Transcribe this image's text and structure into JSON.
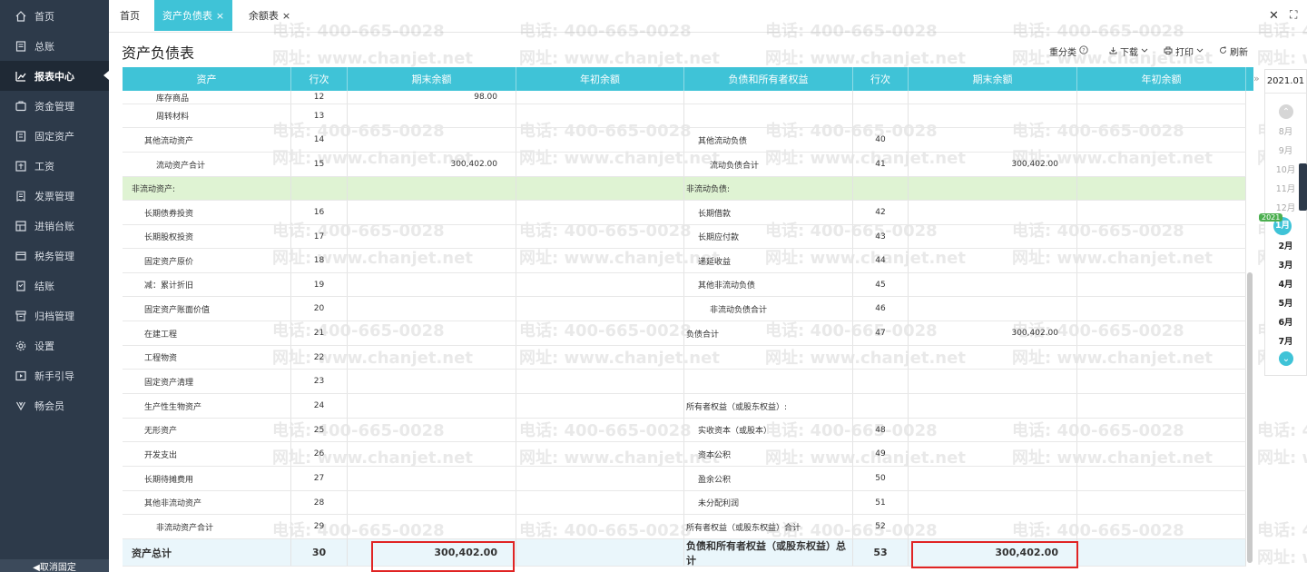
{
  "sidebar": {
    "items": [
      {
        "label": "首页",
        "icon": "home-icon"
      },
      {
        "label": "总账",
        "icon": "ledger-icon"
      },
      {
        "label": "报表中心",
        "icon": "chart-icon"
      },
      {
        "label": "资金管理",
        "icon": "funds-icon"
      },
      {
        "label": "固定资产",
        "icon": "asset-icon"
      },
      {
        "label": "工资",
        "icon": "salary-icon"
      },
      {
        "label": "发票管理",
        "icon": "invoice-icon"
      },
      {
        "label": "进销台账",
        "icon": "inventory-icon"
      },
      {
        "label": "税务管理",
        "icon": "tax-icon"
      },
      {
        "label": "结账",
        "icon": "closing-icon"
      },
      {
        "label": "归档管理",
        "icon": "archive-icon"
      },
      {
        "label": "设置",
        "icon": "settings-icon"
      },
      {
        "label": "新手引导",
        "icon": "guide-icon"
      },
      {
        "label": "畅会员",
        "icon": "vip-icon"
      }
    ],
    "active_index": 2,
    "footer_label": "◀取消固定"
  },
  "tabs": [
    {
      "label": "首页",
      "closable": false
    },
    {
      "label": "资产负债表",
      "closable": true
    },
    {
      "label": "余额表",
      "closable": true
    }
  ],
  "tab_close_glyph": "×",
  "window": {
    "close_glyph": "✕",
    "max_glyph": "⛶"
  },
  "page_title": "资产负债表",
  "toolbar": {
    "reclassify": "重分类",
    "download": "下载",
    "print": "打印",
    "refresh": "刷新"
  },
  "table": {
    "headers": [
      "资产",
      "行次",
      "期末余额",
      "年初余额",
      "负债和所有者权益",
      "行次",
      "期末余额",
      "年初余额"
    ],
    "rows": [
      {
        "left_name": "库存商品",
        "left_line": "12",
        "left_end": "98.00",
        "left_start": "",
        "right_name": "",
        "right_line": "",
        "right_end": "",
        "right_start": "",
        "li": 2,
        "ri": 0
      },
      {
        "left_name": "周转材料",
        "left_line": "13",
        "left_end": "",
        "left_start": "",
        "right_name": "",
        "right_line": "",
        "right_end": "",
        "right_start": "",
        "li": 2,
        "ri": 0
      },
      {
        "left_name": "其他流动资产",
        "left_line": "14",
        "left_end": "",
        "left_start": "",
        "right_name": "其他流动负债",
        "right_line": "40",
        "right_end": "",
        "right_start": "",
        "li": 1,
        "ri": 1
      },
      {
        "left_name": "流动资产合计",
        "left_line": "15",
        "left_end": "300,402.00",
        "left_start": "",
        "right_name": "流动负债合计",
        "right_line": "41",
        "right_end": "300,402.00",
        "right_start": "",
        "li": 2,
        "ri": 2
      },
      {
        "left_name": "非流动资产:",
        "left_line": "",
        "left_end": "",
        "left_start": "",
        "right_name": "非流动负债:",
        "right_line": "",
        "right_end": "",
        "right_start": "",
        "li": 0,
        "ri": 0,
        "section": true
      },
      {
        "left_name": "长期债券投资",
        "left_line": "16",
        "left_end": "",
        "left_start": "",
        "right_name": "长期借款",
        "right_line": "42",
        "right_end": "",
        "right_start": "",
        "li": 1,
        "ri": 1
      },
      {
        "left_name": "长期股权投资",
        "left_line": "17",
        "left_end": "",
        "left_start": "",
        "right_name": "长期应付款",
        "right_line": "43",
        "right_end": "",
        "right_start": "",
        "li": 1,
        "ri": 1
      },
      {
        "left_name": "固定资产原价",
        "left_line": "18",
        "left_end": "",
        "left_start": "",
        "right_name": "递延收益",
        "right_line": "44",
        "right_end": "",
        "right_start": "",
        "li": 1,
        "ri": 1
      },
      {
        "left_name": "减：累计折旧",
        "left_line": "19",
        "left_end": "",
        "left_start": "",
        "right_name": "其他非流动负债",
        "right_line": "45",
        "right_end": "",
        "right_start": "",
        "li": 1,
        "ri": 1
      },
      {
        "left_name": "固定资产账面价值",
        "left_line": "20",
        "left_end": "",
        "left_start": "",
        "right_name": "非流动负债合计",
        "right_line": "46",
        "right_end": "",
        "right_start": "",
        "li": 1,
        "ri": 2
      },
      {
        "left_name": "在建工程",
        "left_line": "21",
        "left_end": "",
        "left_start": "",
        "right_name": "负债合计",
        "right_line": "47",
        "right_end": "300,402.00",
        "right_start": "",
        "li": 1,
        "ri": 0
      },
      {
        "left_name": "工程物资",
        "left_line": "22",
        "left_end": "",
        "left_start": "",
        "right_name": "",
        "right_line": "",
        "right_end": "",
        "right_start": "",
        "li": 1,
        "ri": 0
      },
      {
        "left_name": "固定资产清理",
        "left_line": "23",
        "left_end": "",
        "left_start": "",
        "right_name": "",
        "right_line": "",
        "right_end": "",
        "right_start": "",
        "li": 1,
        "ri": 0
      },
      {
        "left_name": "生产性生物资产",
        "left_line": "24",
        "left_end": "",
        "left_start": "",
        "right_name": "所有者权益（或股东权益）:",
        "right_line": "",
        "right_end": "",
        "right_start": "",
        "li": 1,
        "ri": 0
      },
      {
        "left_name": "无形资产",
        "left_line": "25",
        "left_end": "",
        "left_start": "",
        "right_name": "实收资本（或股本）",
        "right_line": "48",
        "right_end": "",
        "right_start": "",
        "li": 1,
        "ri": 1
      },
      {
        "left_name": "开发支出",
        "left_line": "26",
        "left_end": "",
        "left_start": "",
        "right_name": "资本公积",
        "right_line": "49",
        "right_end": "",
        "right_start": "",
        "li": 1,
        "ri": 1
      },
      {
        "left_name": "长期待摊费用",
        "left_line": "27",
        "left_end": "",
        "left_start": "",
        "right_name": "盈余公积",
        "right_line": "50",
        "right_end": "",
        "right_start": "",
        "li": 1,
        "ri": 1
      },
      {
        "left_name": "其他非流动资产",
        "left_line": "28",
        "left_end": "",
        "left_start": "",
        "right_name": "未分配利润",
        "right_line": "51",
        "right_end": "",
        "right_start": "",
        "li": 1,
        "ri": 1
      },
      {
        "left_name": "非流动资产合计",
        "left_line": "29",
        "left_end": "",
        "left_start": "",
        "right_name": "所有者权益（或股东权益）合计",
        "right_line": "52",
        "right_end": "",
        "right_start": "",
        "li": 2,
        "ri": 0
      }
    ],
    "total_row": {
      "left_name": "资产总计",
      "left_line": "30",
      "left_end": "300,402.00",
      "right_name": "负债和所有者权益（或股东权益）总计",
      "right_line": "53",
      "right_end": "300,402.00"
    }
  },
  "period_panel": {
    "year": "2021.01",
    "year_badge": "2021",
    "months_prev": [
      "8月",
      "9月",
      "10月",
      "11月",
      "12月"
    ],
    "months_current": [
      "1月",
      "2月",
      "3月",
      "4月",
      "5月",
      "6月",
      "7月"
    ],
    "selected": "1月",
    "up_glyph": "⌃",
    "down_glyph": "⌄"
  },
  "watermark": {
    "phone": "电话: 400-665-0028",
    "site": "网址: www.chanjet.net"
  },
  "colors": {
    "accent": "#3fc3d7",
    "sidebar": "#2d3a4a",
    "section_row": "#dff3d3",
    "highlight": "#e02424"
  }
}
